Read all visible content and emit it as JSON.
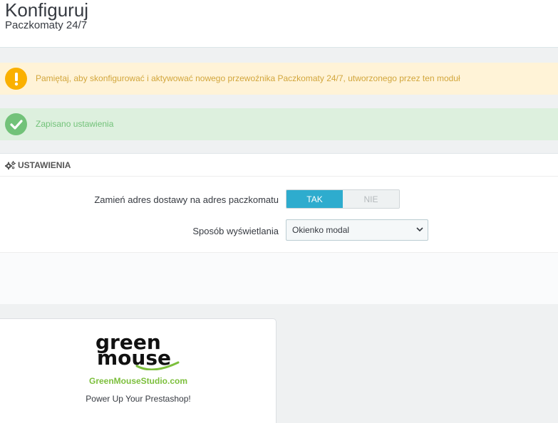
{
  "header": {
    "title": "Konfiguruj",
    "subtitle": "Paczkomaty 24/7"
  },
  "alerts": {
    "warning": {
      "icon": "exclamation-icon",
      "text": "Pamiętaj, aby skonfigurować i aktywować nowego przewoźnika Paczkomaty 24/7, utworzonego przez ten moduł",
      "color": "#fab000"
    },
    "success": {
      "icon": "checkmark-icon",
      "text": "Zapisano ustawienia",
      "color": "#72c279"
    }
  },
  "settings": {
    "heading": "USTAWIENIA",
    "heading_icon": "cogs-icon",
    "address_label": "Zamień adres dostawy na adres paczkomatu",
    "switch_on": "TAK",
    "switch_off": "NIE",
    "switch_value": "TAK",
    "display_label": "Sposób wyświetlania",
    "display_value": "Okienko modal",
    "accent": "#2eacce"
  },
  "promo": {
    "logo_line1": "green",
    "logo_line2": "mouse",
    "link": "GreenMouseStudio.com",
    "tagline": "Power Up Your Prestashop!",
    "brand_color": "#7cbf3c"
  }
}
